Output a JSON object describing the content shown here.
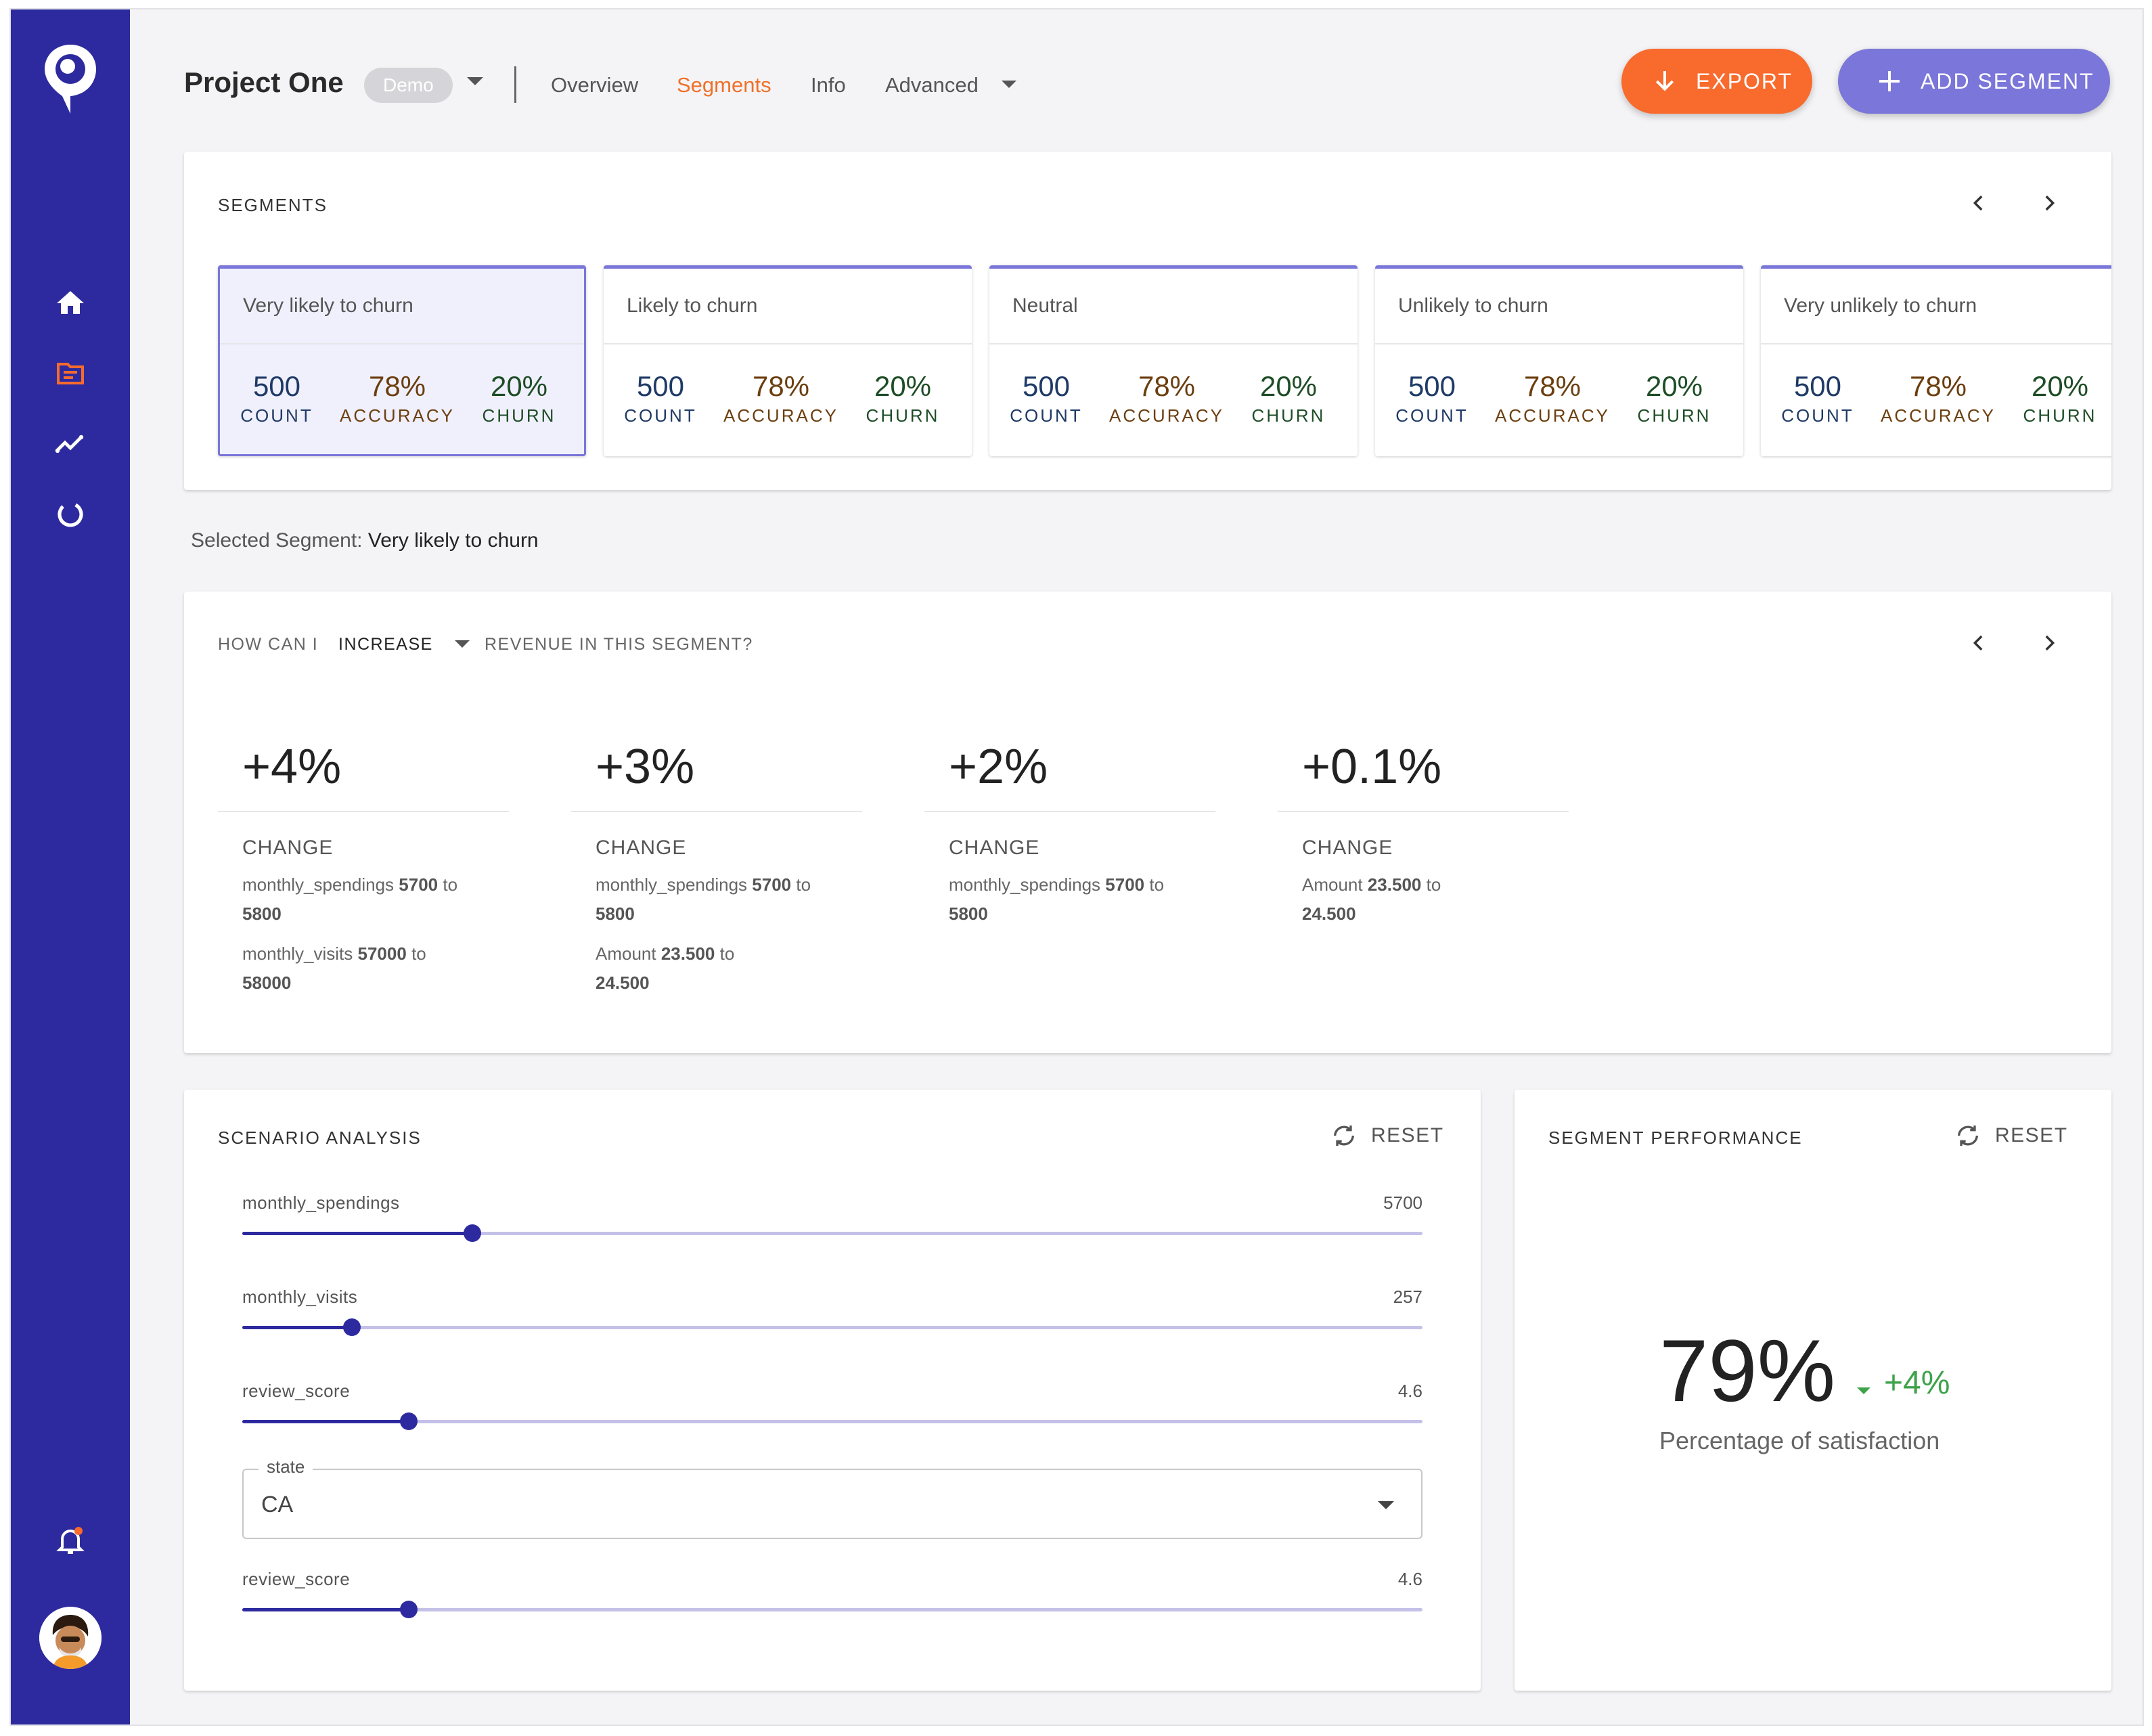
{
  "header": {
    "project_title": "Project One",
    "badge": "Demo",
    "nav": [
      {
        "label": "Overview",
        "active": false
      },
      {
        "label": "Segments",
        "active": true
      },
      {
        "label": "Info",
        "active": false
      },
      {
        "label": "Advanced",
        "active": false
      }
    ],
    "export_label": "EXPORT",
    "add_segment_label": "ADD SEGMENT"
  },
  "sidebar": {
    "items": [
      "home-icon",
      "segments-icon",
      "trend-icon",
      "progress-icon"
    ],
    "active_index": 1
  },
  "segments": {
    "heading": "SEGMENTS",
    "tiles": [
      {
        "name": "Very likely to churn",
        "count": "500",
        "count_label": "COUNT",
        "accuracy": "78%",
        "accuracy_label": "ACCURACY",
        "churn": "20%",
        "churn_label": "CHURN",
        "selected": true
      },
      {
        "name": "Likely to churn",
        "count": "500",
        "count_label": "COUNT",
        "accuracy": "78%",
        "accuracy_label": "ACCURACY",
        "churn": "20%",
        "churn_label": "CHURN",
        "selected": false
      },
      {
        "name": "Neutral",
        "count": "500",
        "count_label": "COUNT",
        "accuracy": "78%",
        "accuracy_label": "ACCURACY",
        "churn": "20%",
        "churn_label": "CHURN",
        "selected": false
      },
      {
        "name": "Unlikely to churn",
        "count": "500",
        "count_label": "COUNT",
        "accuracy": "78%",
        "accuracy_label": "ACCURACY",
        "churn": "20%",
        "churn_label": "CHURN",
        "selected": false
      },
      {
        "name": "Very unlikely to churn",
        "count": "500",
        "count_label": "COUNT",
        "accuracy": "78%",
        "accuracy_label": "ACCURACY",
        "churn": "20%",
        "churn_label": "CHURN",
        "selected": false
      }
    ]
  },
  "selected_segment": {
    "label": "Selected Segment:",
    "value": "Very likely to churn"
  },
  "increase": {
    "prefix": "HOW CAN I",
    "select_value": "INCREASE",
    "suffix": "REVENUE IN THIS SEGMENT?",
    "changes": [
      {
        "value": "+4%",
        "label": "CHANGE",
        "details": [
          {
            "field": "monthly_spendings",
            "from": "5700",
            "to_word": "to",
            "to": "5800"
          },
          {
            "field": "monthly_visits",
            "from": "57000",
            "to_word": "to",
            "to": "58000"
          }
        ]
      },
      {
        "value": "+3%",
        "label": "CHANGE",
        "details": [
          {
            "field": "monthly_spendings",
            "from": "5700",
            "to_word": "to",
            "to": "5800"
          },
          {
            "field": "Amount",
            "from": "23.500",
            "to_word": "to",
            "to": "24.500"
          }
        ]
      },
      {
        "value": "+2%",
        "label": "CHANGE",
        "details": [
          {
            "field": "monthly_spendings",
            "from": "5700",
            "to_word": "to",
            "to": "5800"
          }
        ]
      },
      {
        "value": "+0.1%",
        "label": "CHANGE",
        "details": [
          {
            "field": "Amount",
            "from": "23.500",
            "to_word": "to",
            "to": "24.500"
          }
        ]
      }
    ]
  },
  "scenario": {
    "heading": "SCENARIO ANALYSIS",
    "reset_label": "RESET",
    "sliders": [
      {
        "label": "monthly_spendings",
        "value": "5700",
        "fraction": 0.195
      },
      {
        "label": "monthly_visits",
        "value": "257",
        "fraction": 0.093
      },
      {
        "label": "review_score",
        "value": "4.6",
        "fraction": 0.141
      }
    ],
    "state_select": {
      "legend": "state",
      "value": "CA"
    },
    "sliders_after": [
      {
        "label": "review_score",
        "value": "4.6",
        "fraction": 0.141
      }
    ]
  },
  "performance": {
    "heading": "SEGMENT PERFORMANCE",
    "reset_label": "RESET",
    "value": "79%",
    "delta": "+4%",
    "caption": "Percentage of satisfaction"
  },
  "colors": {
    "sidebar": "#2d2a9f",
    "accent_orange": "#f96a2d",
    "accent_purple": "#7b76d9",
    "positive_green": "#3da24a"
  }
}
